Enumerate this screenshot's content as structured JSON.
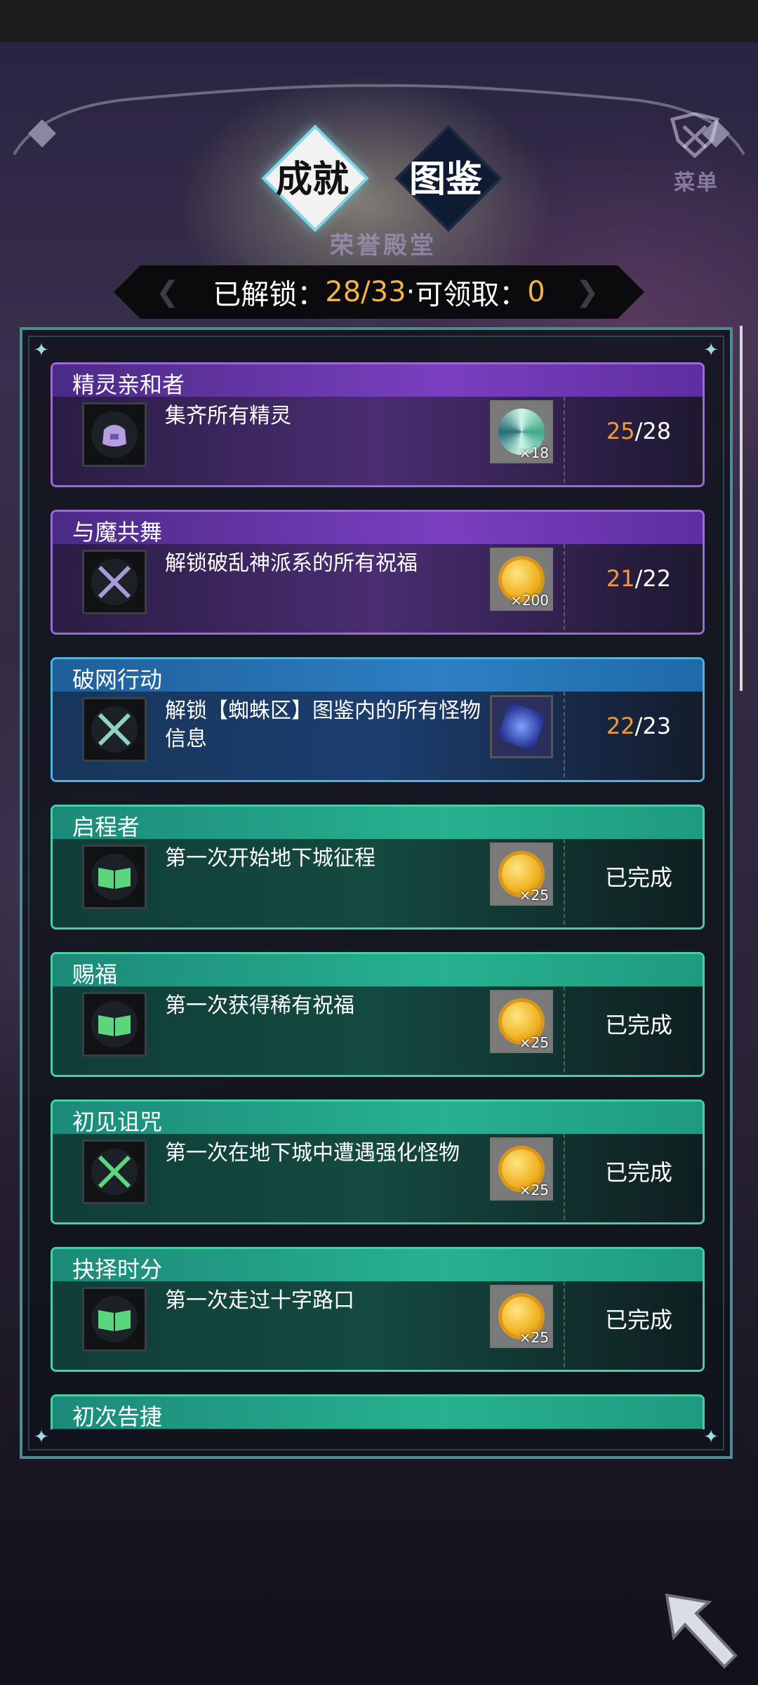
{
  "tabs": [
    {
      "label": "成就",
      "active": true
    },
    {
      "label": "图鉴",
      "active": false
    }
  ],
  "menu_label": "菜单",
  "subtitle": "荣誉殿堂",
  "stats": {
    "unlocked_label": "已解锁：",
    "unlocked_value": "28",
    "unlocked_separator": "/",
    "unlocked_total": "33",
    "dot": " · ",
    "claimable_label": "可领取：",
    "claimable_value": "0"
  },
  "achievements": [
    {
      "title": "精灵亲和者",
      "desc": "集齐所有精灵",
      "reward_icon": "spirit-swirl-icon",
      "reward_qty": "×18",
      "progress_current": "25",
      "progress_sep": "/",
      "progress_total": "28",
      "status": "",
      "color": "purple"
    },
    {
      "title": "与魔共舞",
      "desc": "解锁破乱神派系的所有祝福",
      "reward_icon": "gold-coin-icon",
      "reward_qty": "×200",
      "progress_current": "21",
      "progress_sep": "/",
      "progress_total": "22",
      "status": "",
      "color": "purple"
    },
    {
      "title": "破网行动",
      "desc": "解锁【蜘蛛区】图鉴内的所有怪物信息",
      "reward_icon": "blue-dice-icon",
      "reward_qty": "",
      "progress_current": "22",
      "progress_sep": "/",
      "progress_total": "23",
      "status": "",
      "color": "blue"
    },
    {
      "title": "启程者",
      "desc": "第一次开始地下城征程",
      "reward_icon": "gold-coin-icon",
      "reward_qty": "×25",
      "status": "已完成",
      "color": "green"
    },
    {
      "title": "赐福",
      "desc": "第一次获得稀有祝福",
      "reward_icon": "gold-coin-icon",
      "reward_qty": "×25",
      "status": "已完成",
      "color": "green"
    },
    {
      "title": "初见诅咒",
      "desc": "第一次在地下城中遭遇强化怪物",
      "reward_icon": "gold-coin-icon",
      "reward_qty": "×25",
      "status": "已完成",
      "color": "green"
    },
    {
      "title": "抉择时分",
      "desc": "第一次走过十字路口",
      "reward_icon": "gold-coin-icon",
      "reward_qty": "×25",
      "status": "已完成",
      "color": "green"
    },
    {
      "title": "初次告捷",
      "desc": "",
      "status": "",
      "color": "green"
    }
  ],
  "colors": {
    "progress_current": "#f29a3a",
    "stat_value": "#f2b34a",
    "purple_border": "#9b6ad4",
    "blue_border": "#4fb3e0",
    "green_border": "#47d0a8"
  }
}
